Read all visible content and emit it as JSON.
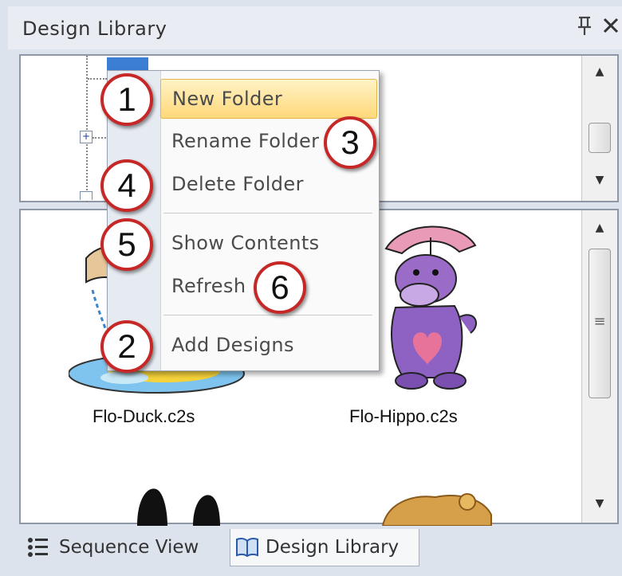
{
  "panel": {
    "title": "Design Library",
    "pin_glyph": "ꟷ",
    "close_glyph": "✕"
  },
  "tree": {
    "expander_glyph": "+"
  },
  "menu": {
    "items": [
      {
        "label": "New Folder",
        "badge": "1"
      },
      {
        "label": "Rename Folder",
        "badge": "3"
      },
      {
        "label": "Delete Folder",
        "badge": "4"
      },
      {
        "label": "Show Contents",
        "badge": "5"
      },
      {
        "label": "Refresh",
        "badge": "6"
      },
      {
        "label": "Add Designs",
        "badge": "2"
      }
    ]
  },
  "designs": [
    {
      "name": "Flo-Duck.c2s"
    },
    {
      "name": "Flo-Hippo.c2s"
    }
  ],
  "tabs": [
    {
      "label": "Sequence View",
      "icon": "list-icon"
    },
    {
      "label": "Design Library",
      "icon": "book-icon"
    }
  ],
  "colors": {
    "accent_highlight": "#ffd87a",
    "badge_ring": "#c62828",
    "selection": "#3a7fd4"
  }
}
